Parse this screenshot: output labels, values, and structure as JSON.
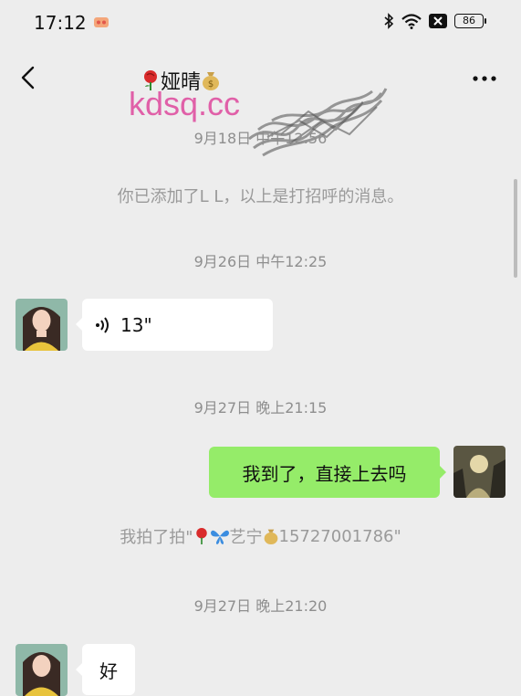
{
  "status_bar": {
    "time": "17:12",
    "battery": "86"
  },
  "nav": {
    "title": "娅晴",
    "title_prefix_icon": "rose-icon",
    "title_suffix_icon": "money-bag-icon",
    "watermark": "kdsq.cc"
  },
  "messages": {
    "ts1": "9月18日 中午12:56",
    "sys1": "你已添加了L L，以上是打招呼的消息。",
    "ts2": "9月26日 中午12:25",
    "voice_duration": "13\"",
    "ts3": "9月27日 晚上21:15",
    "outgoing_text": "我到了，直接上去吗",
    "sys2_prefix": "我拍了拍\"",
    "sys2_name": "艺宁",
    "sys2_phone": "15727001786\"",
    "ts4": "9月27日 晚上21:20",
    "incoming_text": "好"
  },
  "colors": {
    "background": "#ededed",
    "outgoing_bubble": "#95ec69",
    "incoming_bubble": "#ffffff",
    "watermark": "#e060a8"
  }
}
